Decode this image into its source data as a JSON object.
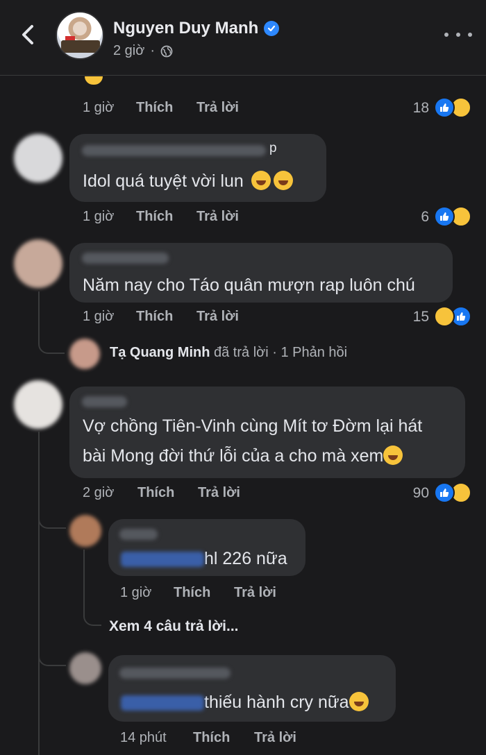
{
  "header": {
    "author": "Nguyen Duy Manh",
    "time": "2 giờ"
  },
  "labels": {
    "like": "Thích",
    "reply": "Trả lời"
  },
  "comments": [
    {
      "time": "1 giờ",
      "count": "18"
    },
    {
      "text": "Idol quá tuyệt vời lun",
      "time": "1 giờ",
      "count": "6",
      "name_suffix": "p"
    },
    {
      "text": "Năm nay cho Táo quân mượn rap luôn chú",
      "time": "1 giờ",
      "count": "15"
    },
    {
      "text_line1": "Vợ chồng Tiên-Vinh cùng Mít tơ Đờm lại hát",
      "text_line2": "bài Mong đời thứ lỗi của a cho mà xem",
      "time": "2 giờ",
      "count": "90"
    }
  ],
  "reply_summary": {
    "name": "Tạ Quang Minh",
    "action": "đã trả lời",
    "count": "1 Phản hồi"
  },
  "replies": [
    {
      "text": "hl 226 nữa",
      "time": "1 giờ"
    },
    {
      "text": "thiếu hành cry nữa",
      "time": "14 phút"
    }
  ],
  "see_more": "Xem 4 câu trả lời...",
  "colors": {
    "background": "#1a1a1c",
    "bubble": "#2f3033",
    "like": "#1877f2",
    "haha": "#f7c33b",
    "verified": "#2d88ff"
  }
}
